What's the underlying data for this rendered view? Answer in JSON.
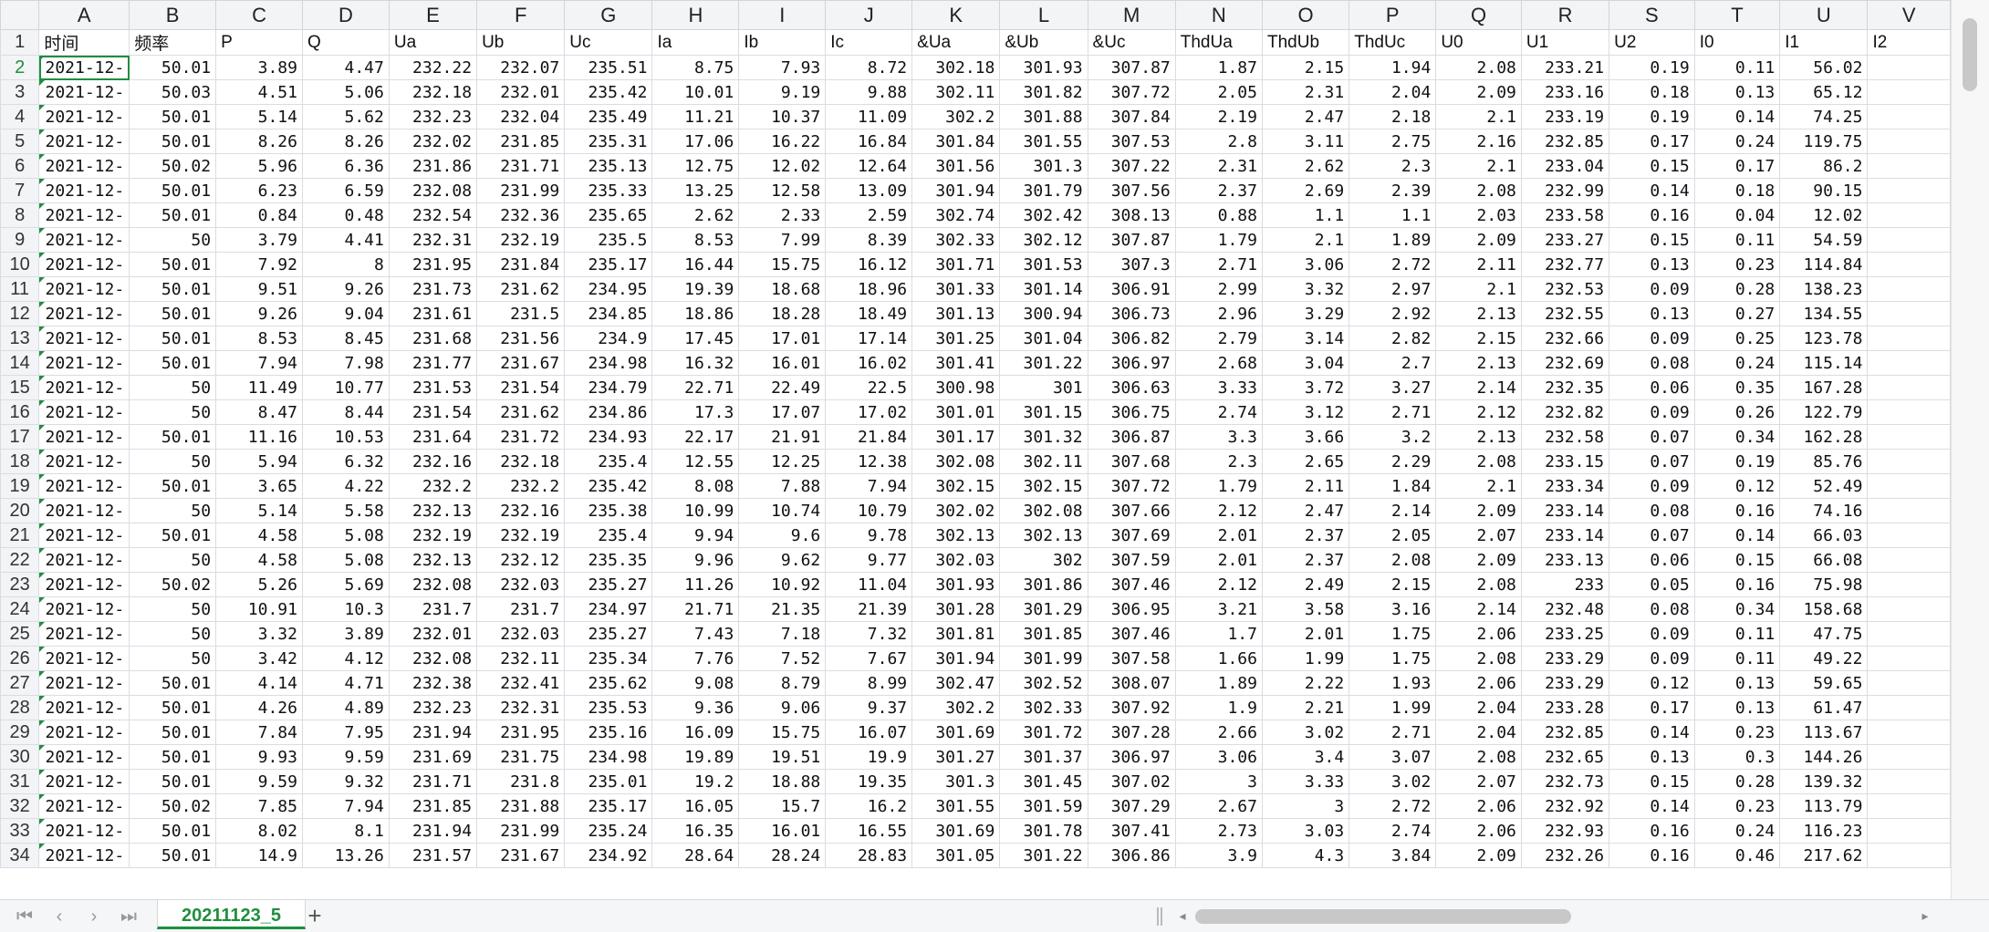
{
  "sheet_tab": "20211123_5",
  "icons": {
    "first": "⏮",
    "prev": "‹",
    "next": "›",
    "last": "⏭",
    "add": "+"
  },
  "column_letters": [
    "A",
    "B",
    "C",
    "D",
    "E",
    "F",
    "G",
    "H",
    "I",
    "J",
    "K",
    "L",
    "M",
    "N",
    "O",
    "P",
    "Q",
    "R",
    "S",
    "T",
    "U",
    "V"
  ],
  "headers": [
    "时间",
    "频率",
    "P",
    "Q",
    "Ua",
    "Ub",
    "Uc",
    "Ia",
    "Ib",
    "Ic",
    "&Ua",
    "&Ub",
    "&Uc",
    "ThdUa",
    "ThdUb",
    "ThdUc",
    "U0",
    "U1",
    "U2",
    "I0",
    "I1",
    "I2"
  ],
  "rows": [
    [
      "2021-12-",
      "50.01",
      "3.89",
      "4.47",
      "232.22",
      "232.07",
      "235.51",
      "8.75",
      "7.93",
      "8.72",
      "302.18",
      "301.93",
      "307.87",
      "1.87",
      "2.15",
      "1.94",
      "2.08",
      "233.21",
      "0.19",
      "0.11",
      "56.02"
    ],
    [
      "2021-12-",
      "50.03",
      "4.51",
      "5.06",
      "232.18",
      "232.01",
      "235.42",
      "10.01",
      "9.19",
      "9.88",
      "302.11",
      "301.82",
      "307.72",
      "2.05",
      "2.31",
      "2.04",
      "2.09",
      "233.16",
      "0.18",
      "0.13",
      "65.12"
    ],
    [
      "2021-12-",
      "50.01",
      "5.14",
      "5.62",
      "232.23",
      "232.04",
      "235.49",
      "11.21",
      "10.37",
      "11.09",
      "302.2",
      "301.88",
      "307.84",
      "2.19",
      "2.47",
      "2.18",
      "2.1",
      "233.19",
      "0.19",
      "0.14",
      "74.25"
    ],
    [
      "2021-12-",
      "50.01",
      "8.26",
      "8.26",
      "232.02",
      "231.85",
      "235.31",
      "17.06",
      "16.22",
      "16.84",
      "301.84",
      "301.55",
      "307.53",
      "2.8",
      "3.11",
      "2.75",
      "2.16",
      "232.85",
      "0.17",
      "0.24",
      "119.75"
    ],
    [
      "2021-12-",
      "50.02",
      "5.96",
      "6.36",
      "231.86",
      "231.71",
      "235.13",
      "12.75",
      "12.02",
      "12.64",
      "301.56",
      "301.3",
      "307.22",
      "2.31",
      "2.62",
      "2.3",
      "2.1",
      "233.04",
      "0.15",
      "0.17",
      "86.2"
    ],
    [
      "2021-12-",
      "50.01",
      "6.23",
      "6.59",
      "232.08",
      "231.99",
      "235.33",
      "13.25",
      "12.58",
      "13.09",
      "301.94",
      "301.79",
      "307.56",
      "2.37",
      "2.69",
      "2.39",
      "2.08",
      "232.99",
      "0.14",
      "0.18",
      "90.15"
    ],
    [
      "2021-12-",
      "50.01",
      "0.84",
      "0.48",
      "232.54",
      "232.36",
      "235.65",
      "2.62",
      "2.33",
      "2.59",
      "302.74",
      "302.42",
      "308.13",
      "0.88",
      "1.1",
      "1.1",
      "2.03",
      "233.58",
      "0.16",
      "0.04",
      "12.02"
    ],
    [
      "2021-12-",
      "50",
      "3.79",
      "4.41",
      "232.31",
      "232.19",
      "235.5",
      "8.53",
      "7.99",
      "8.39",
      "302.33",
      "302.12",
      "307.87",
      "1.79",
      "2.1",
      "1.89",
      "2.09",
      "233.27",
      "0.15",
      "0.11",
      "54.59"
    ],
    [
      "2021-12-",
      "50.01",
      "7.92",
      "8",
      "231.95",
      "231.84",
      "235.17",
      "16.44",
      "15.75",
      "16.12",
      "301.71",
      "301.53",
      "307.3",
      "2.71",
      "3.06",
      "2.72",
      "2.11",
      "232.77",
      "0.13",
      "0.23",
      "114.84"
    ],
    [
      "2021-12-",
      "50.01",
      "9.51",
      "9.26",
      "231.73",
      "231.62",
      "234.95",
      "19.39",
      "18.68",
      "18.96",
      "301.33",
      "301.14",
      "306.91",
      "2.99",
      "3.32",
      "2.97",
      "2.1",
      "232.53",
      "0.09",
      "0.28",
      "138.23"
    ],
    [
      "2021-12-",
      "50.01",
      "9.26",
      "9.04",
      "231.61",
      "231.5",
      "234.85",
      "18.86",
      "18.28",
      "18.49",
      "301.13",
      "300.94",
      "306.73",
      "2.96",
      "3.29",
      "2.92",
      "2.13",
      "232.55",
      "0.13",
      "0.27",
      "134.55"
    ],
    [
      "2021-12-",
      "50.01",
      "8.53",
      "8.45",
      "231.68",
      "231.56",
      "234.9",
      "17.45",
      "17.01",
      "17.14",
      "301.25",
      "301.04",
      "306.82",
      "2.79",
      "3.14",
      "2.82",
      "2.15",
      "232.66",
      "0.09",
      "0.25",
      "123.78"
    ],
    [
      "2021-12-",
      "50.01",
      "7.94",
      "7.98",
      "231.77",
      "231.67",
      "234.98",
      "16.32",
      "16.01",
      "16.02",
      "301.41",
      "301.22",
      "306.97",
      "2.68",
      "3.04",
      "2.7",
      "2.13",
      "232.69",
      "0.08",
      "0.24",
      "115.14"
    ],
    [
      "2021-12-",
      "50",
      "11.49",
      "10.77",
      "231.53",
      "231.54",
      "234.79",
      "22.71",
      "22.49",
      "22.5",
      "300.98",
      "301",
      "306.63",
      "3.33",
      "3.72",
      "3.27",
      "2.14",
      "232.35",
      "0.06",
      "0.35",
      "167.28"
    ],
    [
      "2021-12-",
      "50",
      "8.47",
      "8.44",
      "231.54",
      "231.62",
      "234.86",
      "17.3",
      "17.07",
      "17.02",
      "301.01",
      "301.15",
      "306.75",
      "2.74",
      "3.12",
      "2.71",
      "2.12",
      "232.82",
      "0.09",
      "0.26",
      "122.79"
    ],
    [
      "2021-12-",
      "50.01",
      "11.16",
      "10.53",
      "231.64",
      "231.72",
      "234.93",
      "22.17",
      "21.91",
      "21.84",
      "301.17",
      "301.32",
      "306.87",
      "3.3",
      "3.66",
      "3.2",
      "2.13",
      "232.58",
      "0.07",
      "0.34",
      "162.28"
    ],
    [
      "2021-12-",
      "50",
      "5.94",
      "6.32",
      "232.16",
      "232.18",
      "235.4",
      "12.55",
      "12.25",
      "12.38",
      "302.08",
      "302.11",
      "307.68",
      "2.3",
      "2.65",
      "2.29",
      "2.08",
      "233.15",
      "0.07",
      "0.19",
      "85.76"
    ],
    [
      "2021-12-",
      "50.01",
      "3.65",
      "4.22",
      "232.2",
      "232.2",
      "235.42",
      "8.08",
      "7.88",
      "7.94",
      "302.15",
      "302.15",
      "307.72",
      "1.79",
      "2.11",
      "1.84",
      "2.1",
      "233.34",
      "0.09",
      "0.12",
      "52.49"
    ],
    [
      "2021-12-",
      "50",
      "5.14",
      "5.58",
      "232.13",
      "232.16",
      "235.38",
      "10.99",
      "10.74",
      "10.79",
      "302.02",
      "302.08",
      "307.66",
      "2.12",
      "2.47",
      "2.14",
      "2.09",
      "233.14",
      "0.08",
      "0.16",
      "74.16"
    ],
    [
      "2021-12-",
      "50.01",
      "4.58",
      "5.08",
      "232.19",
      "232.19",
      "235.4",
      "9.94",
      "9.6",
      "9.78",
      "302.13",
      "302.13",
      "307.69",
      "2.01",
      "2.37",
      "2.05",
      "2.07",
      "233.14",
      "0.07",
      "0.14",
      "66.03"
    ],
    [
      "2021-12-",
      "50",
      "4.58",
      "5.08",
      "232.13",
      "232.12",
      "235.35",
      "9.96",
      "9.62",
      "9.77",
      "302.03",
      "302",
      "307.59",
      "2.01",
      "2.37",
      "2.08",
      "2.09",
      "233.13",
      "0.06",
      "0.15",
      "66.08"
    ],
    [
      "2021-12-",
      "50.02",
      "5.26",
      "5.69",
      "232.08",
      "232.03",
      "235.27",
      "11.26",
      "10.92",
      "11.04",
      "301.93",
      "301.86",
      "307.46",
      "2.12",
      "2.49",
      "2.15",
      "2.08",
      "233",
      "0.05",
      "0.16",
      "75.98"
    ],
    [
      "2021-12-",
      "50",
      "10.91",
      "10.3",
      "231.7",
      "231.7",
      "234.97",
      "21.71",
      "21.35",
      "21.39",
      "301.28",
      "301.29",
      "306.95",
      "3.21",
      "3.58",
      "3.16",
      "2.14",
      "232.48",
      "0.08",
      "0.34",
      "158.68"
    ],
    [
      "2021-12-",
      "50",
      "3.32",
      "3.89",
      "232.01",
      "232.03",
      "235.27",
      "7.43",
      "7.18",
      "7.32",
      "301.81",
      "301.85",
      "307.46",
      "1.7",
      "2.01",
      "1.75",
      "2.06",
      "233.25",
      "0.09",
      "0.11",
      "47.75"
    ],
    [
      "2021-12-",
      "50",
      "3.42",
      "4.12",
      "232.08",
      "232.11",
      "235.34",
      "7.76",
      "7.52",
      "7.67",
      "301.94",
      "301.99",
      "307.58",
      "1.66",
      "1.99",
      "1.75",
      "2.08",
      "233.29",
      "0.09",
      "0.11",
      "49.22"
    ],
    [
      "2021-12-",
      "50.01",
      "4.14",
      "4.71",
      "232.38",
      "232.41",
      "235.62",
      "9.08",
      "8.79",
      "8.99",
      "302.47",
      "302.52",
      "308.07",
      "1.89",
      "2.22",
      "1.93",
      "2.06",
      "233.29",
      "0.12",
      "0.13",
      "59.65"
    ],
    [
      "2021-12-",
      "50.01",
      "4.26",
      "4.89",
      "232.23",
      "232.31",
      "235.53",
      "9.36",
      "9.06",
      "9.37",
      "302.2",
      "302.33",
      "307.92",
      "1.9",
      "2.21",
      "1.99",
      "2.04",
      "233.28",
      "0.17",
      "0.13",
      "61.47"
    ],
    [
      "2021-12-",
      "50.01",
      "7.84",
      "7.95",
      "231.94",
      "231.95",
      "235.16",
      "16.09",
      "15.75",
      "16.07",
      "301.69",
      "301.72",
      "307.28",
      "2.66",
      "3.02",
      "2.71",
      "2.04",
      "232.85",
      "0.14",
      "0.23",
      "113.67"
    ],
    [
      "2021-12-",
      "50.01",
      "9.93",
      "9.59",
      "231.69",
      "231.75",
      "234.98",
      "19.89",
      "19.51",
      "19.9",
      "301.27",
      "301.37",
      "306.97",
      "3.06",
      "3.4",
      "3.07",
      "2.08",
      "232.65",
      "0.13",
      "0.3",
      "144.26"
    ],
    [
      "2021-12-",
      "50.01",
      "9.59",
      "9.32",
      "231.71",
      "231.8",
      "235.01",
      "19.2",
      "18.88",
      "19.35",
      "301.3",
      "301.45",
      "307.02",
      "3",
      "3.33",
      "3.02",
      "2.07",
      "232.73",
      "0.15",
      "0.28",
      "139.32"
    ],
    [
      "2021-12-",
      "50.02",
      "7.85",
      "7.94",
      "231.85",
      "231.88",
      "235.17",
      "16.05",
      "15.7",
      "16.2",
      "301.55",
      "301.59",
      "307.29",
      "2.67",
      "3",
      "2.72",
      "2.06",
      "232.92",
      "0.14",
      "0.23",
      "113.79"
    ],
    [
      "2021-12-",
      "50.01",
      "8.02",
      "8.1",
      "231.94",
      "231.99",
      "235.24",
      "16.35",
      "16.01",
      "16.55",
      "301.69",
      "301.78",
      "307.41",
      "2.73",
      "3.03",
      "2.74",
      "2.06",
      "232.93",
      "0.16",
      "0.24",
      "116.23"
    ],
    [
      "2021-12-",
      "50.01",
      "14.9",
      "13.26",
      "231.57",
      "231.67",
      "234.92",
      "28.64",
      "28.24",
      "28.83",
      "301.05",
      "301.22",
      "306.86",
      "3.9",
      "4.3",
      "3.84",
      "2.09",
      "232.26",
      "0.16",
      "0.46",
      "217.62"
    ]
  ]
}
